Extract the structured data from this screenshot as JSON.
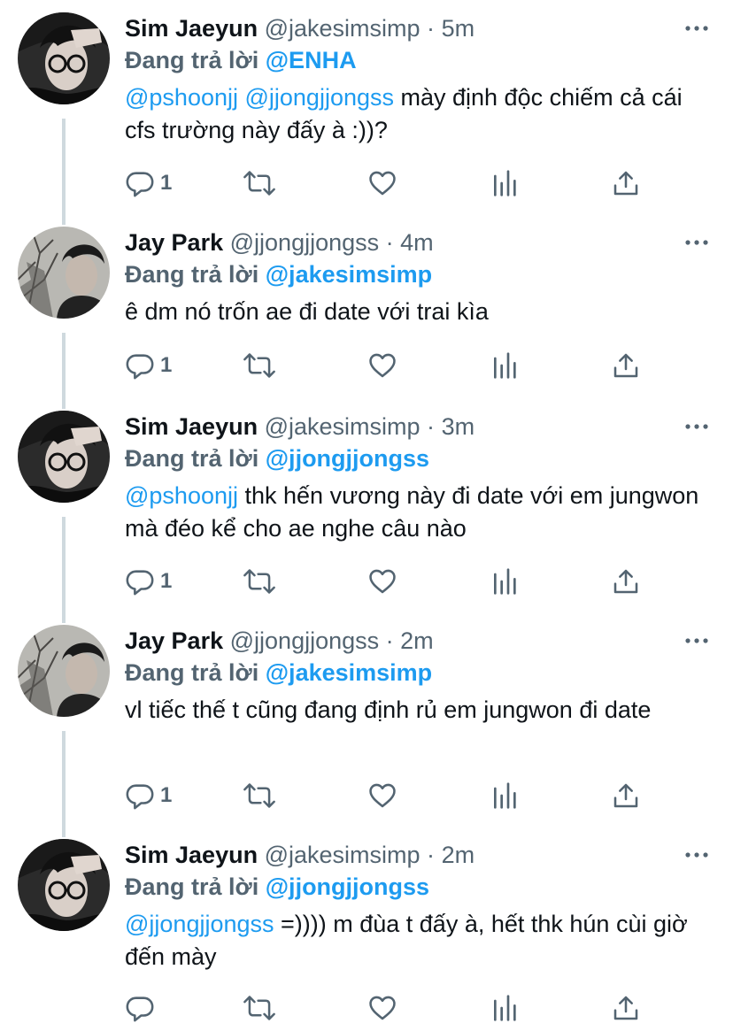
{
  "tweets": [
    {
      "name": "Sim Jaeyun",
      "handle": "@jakesimsimp",
      "dot": "·",
      "time": "5m",
      "reply_label": "Đang trả lời",
      "reply_handle": "@ENHA",
      "mentions": "@pshoonjj @jjongjjongss",
      "text": " mày định độc chiếm cả cái cfs trường này đấy à :))?",
      "reply_count": "1",
      "avatar": "sim"
    },
    {
      "name": "Jay Park",
      "handle": "@jjongjjongss",
      "dot": "·",
      "time": "4m",
      "reply_label": "Đang trả lời",
      "reply_handle": "@jakesimsimp",
      "mentions": "",
      "text": "ê dm nó trốn ae đi date với trai kìa",
      "reply_count": "1",
      "avatar": "jay"
    },
    {
      "name": "Sim Jaeyun",
      "handle": "@jakesimsimp",
      "dot": "·",
      "time": "3m",
      "reply_label": "Đang trả lời",
      "reply_handle": "@jjongjjongss",
      "mentions": "@pshoonjj",
      "text": " thk hến vương này đi date với em jungwon mà đéo kể cho ae nghe câu nào",
      "reply_count": "1",
      "avatar": "sim"
    },
    {
      "name": "Jay Park",
      "handle": "@jjongjjongss",
      "dot": "·",
      "time": "2m",
      "reply_label": "Đang trả lời",
      "reply_handle": "@jakesimsimp",
      "mentions": "",
      "text": "vl tiếc thế t cũng đang định rủ em jungwon đi date",
      "reply_count": "1",
      "avatar": "jay"
    },
    {
      "name": "Sim Jaeyun",
      "handle": "@jakesimsimp",
      "dot": "·",
      "time": "2m",
      "reply_label": "Đang trả lời",
      "reply_handle": "@jjongjjongss",
      "mentions": "@jjongjjongss",
      "text": " =)))) m đùa t đấy à, hết thk hún cùi giờ đến mày",
      "reply_count": "",
      "avatar": "sim"
    }
  ],
  "colors": {
    "link": "#1d9bf0",
    "secondary": "#536471",
    "thread_line": "#cfd9de"
  },
  "icons": [
    "more-icon",
    "reply-icon",
    "retweet-icon",
    "like-icon",
    "views-icon",
    "share-icon"
  ]
}
